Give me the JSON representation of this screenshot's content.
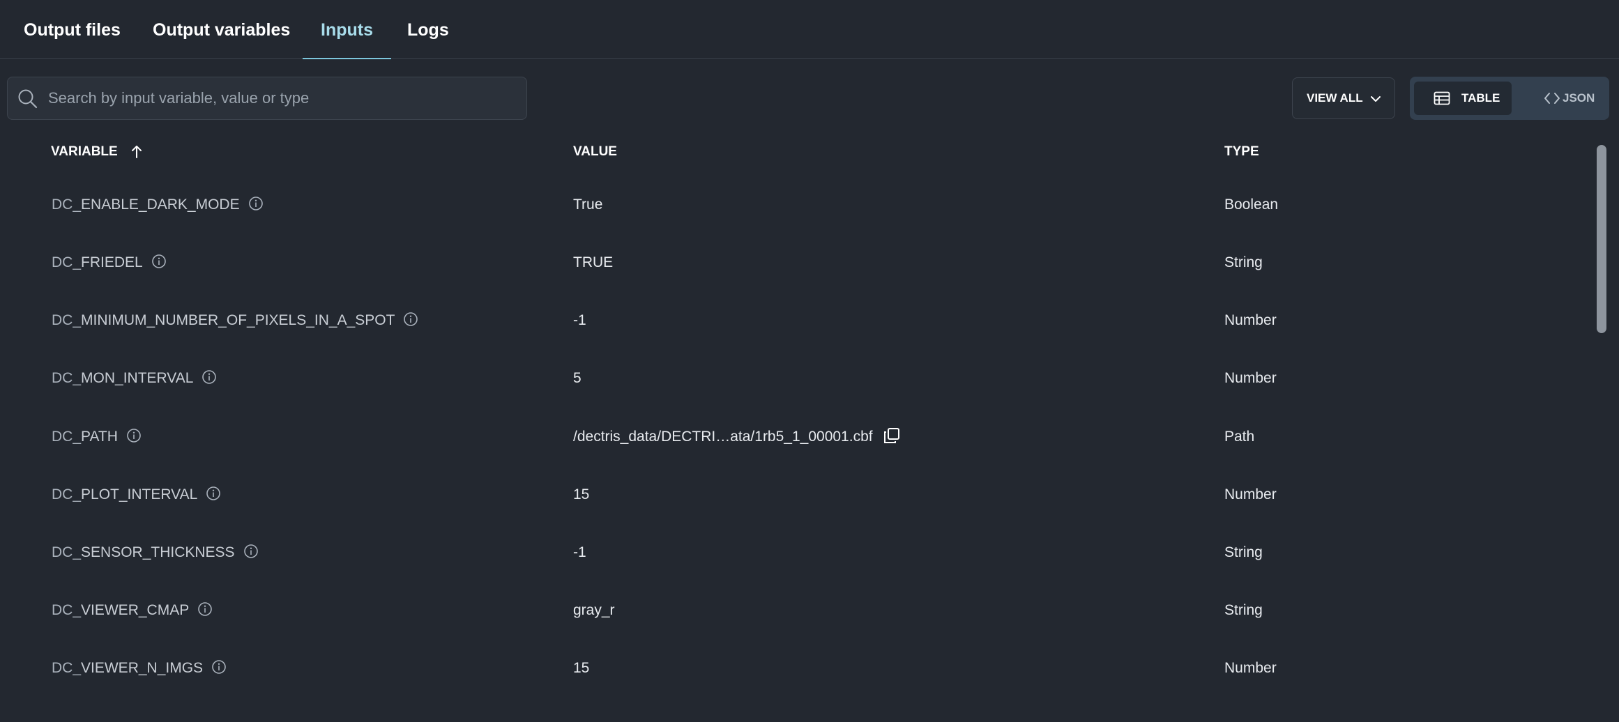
{
  "tabs": [
    {
      "label": "Output files"
    },
    {
      "label": "Output variables"
    },
    {
      "label": "Inputs"
    },
    {
      "label": "Logs"
    }
  ],
  "search": {
    "placeholder": "Search by input variable, value or type",
    "icon": "search-icon"
  },
  "view_all": {
    "label": "VIEW ALL",
    "icon": "chevron-down-icon"
  },
  "view_toggle": {
    "table_label": "TABLE",
    "json_label": "JSON",
    "selected": "TABLE"
  },
  "table": {
    "headers": {
      "variable": "VARIABLE",
      "value": "VALUE",
      "type": "TYPE"
    },
    "sort": {
      "column": "VARIABLE",
      "direction": "ascending"
    },
    "rows": [
      {
        "prefix": "DC_",
        "name": "ENABLE_DARK_MODE",
        "value": "True",
        "type": "Boolean"
      },
      {
        "prefix": "DC_",
        "name": "FRIEDEL",
        "value": "TRUE",
        "type": "String"
      },
      {
        "prefix": "DC_",
        "name": "MINIMUM_NUMBER_OF_PIXELS_IN_A_SPOT",
        "value": "-1",
        "type": "Number"
      },
      {
        "prefix": "DC_",
        "name": "MON_INTERVAL",
        "value": "5",
        "type": "Number"
      },
      {
        "prefix": "DC_",
        "name": "PATH",
        "value": "/dectris_data/DECTRI…ata/1rb5_1_00001.cbf",
        "type": "Path"
      },
      {
        "prefix": "DC_",
        "name": "PLOT_INTERVAL",
        "value": "15",
        "type": "Number"
      },
      {
        "prefix": "DC_",
        "name": "SENSOR_THICKNESS",
        "value": "-1",
        "type": "String"
      },
      {
        "prefix": "DC_",
        "name": "VIEWER_CMAP",
        "value": "gray_r",
        "type": "String"
      },
      {
        "prefix": "DC_",
        "name": "VIEWER_N_IMGS",
        "value": "15",
        "type": "Number"
      }
    ]
  },
  "colors": {
    "background": "#232830",
    "active_tab": "#a8dcea",
    "tab_underline": "#7cc6dc",
    "toggle_bg": "#33404f"
  }
}
